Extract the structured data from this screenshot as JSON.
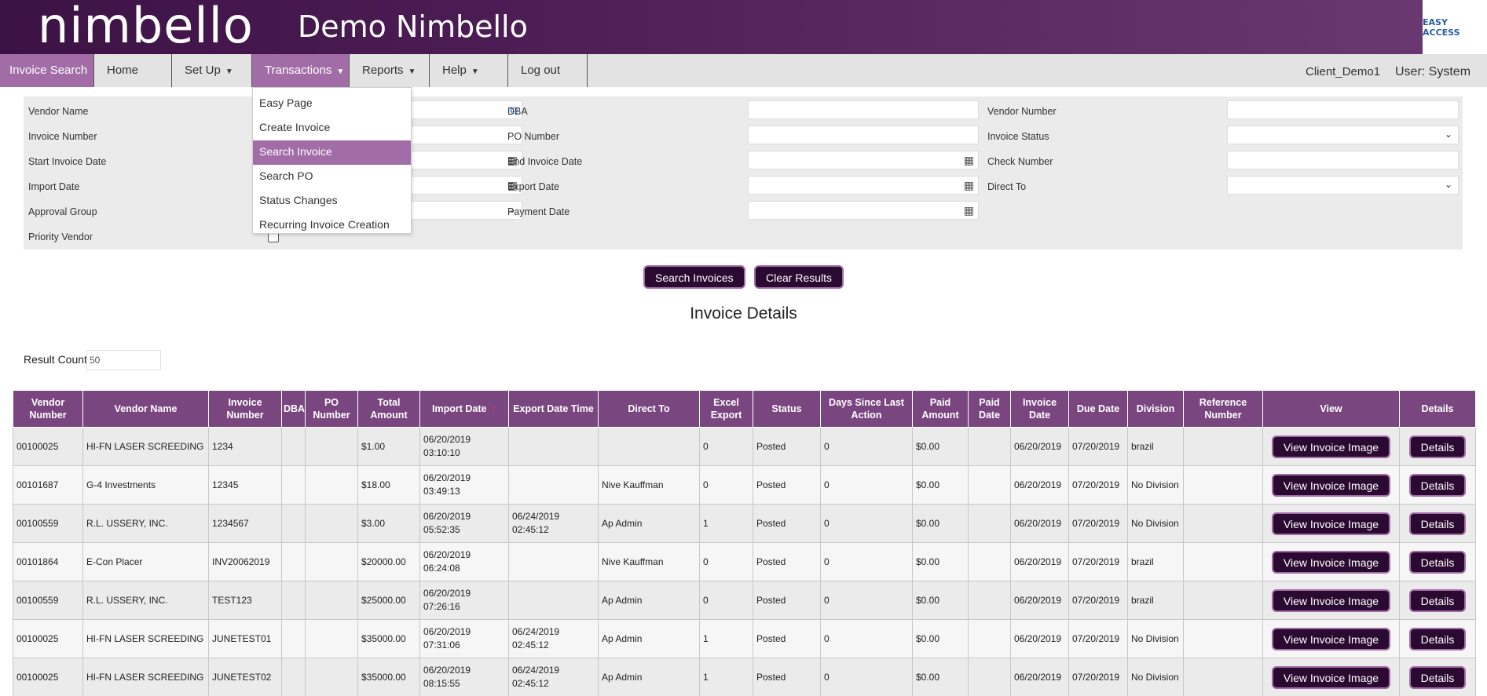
{
  "header": {
    "logo": "nimbello",
    "title": "Demo Nimbello",
    "partner_logo": "EASY ACCESS"
  },
  "nav": {
    "items": [
      {
        "label": "Invoice Search",
        "caret": false
      },
      {
        "label": "Home",
        "caret": false
      },
      {
        "label": "Set Up",
        "caret": true
      },
      {
        "label": "Transactions",
        "caret": true
      },
      {
        "label": "Reports",
        "caret": true
      },
      {
        "label": "Help",
        "caret": true
      },
      {
        "label": "Log out",
        "caret": false
      }
    ],
    "caret_glyph": "▼",
    "client": "Client_Demo1",
    "user": "User: System"
  },
  "transactions_menu": {
    "items": [
      "Easy Page",
      "Create Invoice",
      "Search Invoice",
      "Search PO",
      "Status Changes",
      "Recurring Invoice Creation"
    ],
    "selected": "Search Invoice"
  },
  "filters": {
    "vendor_name": {
      "label": "Vendor Name",
      "value": ""
    },
    "dba": {
      "label": "DBA",
      "value": ""
    },
    "vendor_number": {
      "label": "Vendor Number",
      "value": ""
    },
    "invoice_number": {
      "label": "Invoice Number",
      "value": ""
    },
    "po_number": {
      "label": "PO Number",
      "value": ""
    },
    "invoice_status": {
      "label": "Invoice Status",
      "value": ""
    },
    "start_invoice_date": {
      "label": "Start Invoice Date",
      "value": ""
    },
    "end_invoice_date": {
      "label": "End Invoice Date",
      "value": ""
    },
    "check_number": {
      "label": "Check Number",
      "value": ""
    },
    "import_date": {
      "label": "Import Date",
      "value": ""
    },
    "export_date": {
      "label": "Export Date",
      "value": ""
    },
    "direct_to": {
      "label": "Direct To",
      "value": ""
    },
    "approval_group": {
      "label": "Approval Group",
      "value": ""
    },
    "payment_date": {
      "label": "Payment Date",
      "value": ""
    },
    "priority_vendor": {
      "label": "Priority Vendor",
      "checked": false
    }
  },
  "icons": {
    "external_link": "⧉",
    "calendar": "▦",
    "chevron_down": "⌄"
  },
  "actions": {
    "search": "Search Invoices",
    "clear": "Clear Results"
  },
  "section_title": "Invoice Details",
  "result_count": {
    "label": "Result Count",
    "value": "50"
  },
  "table": {
    "columns": [
      "Vendor Number",
      "Vendor Name",
      "Invoice Number",
      "DBA",
      "PO Number",
      "Total Amount",
      "Import Date",
      "Export Date Time",
      "Direct To",
      "Excel Export",
      "Status",
      "Days Since Last Action",
      "Paid Amount",
      "Paid Date",
      "Invoice Date",
      "Due Date",
      "Division",
      "Reference Number",
      "View",
      "Details"
    ],
    "sort_indicator": "↑",
    "view_button": "View Invoice Image",
    "details_button": "Details",
    "rows": [
      {
        "vendor_number": "00100025",
        "vendor_name": "HI-FN LASER SCREEDING",
        "invoice_number": "1234",
        "dba": "",
        "po_number": "",
        "total_amount": "$1.00",
        "import_date": "06/20/2019 03:10:10",
        "export_date_time": "",
        "direct_to": "",
        "excel_export": "0",
        "status": "Posted",
        "days_since": "0",
        "paid_amount": "$0.00",
        "paid_date": "",
        "invoice_date": "06/20/2019",
        "due_date": "07/20/2019",
        "division": "brazil",
        "reference_number": ""
      },
      {
        "vendor_number": "00101687",
        "vendor_name": "G-4 Investments",
        "invoice_number": "12345",
        "dba": "",
        "po_number": "",
        "total_amount": "$18.00",
        "import_date": "06/20/2019 03:49:13",
        "export_date_time": "",
        "direct_to": "Nive Kauffman",
        "excel_export": "0",
        "status": "Posted",
        "days_since": "0",
        "paid_amount": "$0.00",
        "paid_date": "",
        "invoice_date": "06/20/2019",
        "due_date": "07/20/2019",
        "division": "No Division",
        "reference_number": ""
      },
      {
        "vendor_number": "00100559",
        "vendor_name": "R.L. USSERY, INC.",
        "invoice_number": "1234567",
        "dba": "",
        "po_number": "",
        "total_amount": "$3.00",
        "import_date": "06/20/2019 05:52:35",
        "export_date_time": "06/24/2019 02:45:12",
        "direct_to": "Ap Admin",
        "excel_export": "1",
        "status": "Posted",
        "days_since": "0",
        "paid_amount": "$0.00",
        "paid_date": "",
        "invoice_date": "06/20/2019",
        "due_date": "07/20/2019",
        "division": "No Division",
        "reference_number": ""
      },
      {
        "vendor_number": "00101864",
        "vendor_name": "E-Con Placer",
        "invoice_number": "INV20062019",
        "dba": "",
        "po_number": "",
        "total_amount": "$20000.00",
        "import_date": "06/20/2019 06:24:08",
        "export_date_time": "",
        "direct_to": "Nive Kauffman",
        "excel_export": "0",
        "status": "Posted",
        "days_since": "0",
        "paid_amount": "$0.00",
        "paid_date": "",
        "invoice_date": "06/20/2019",
        "due_date": "07/20/2019",
        "division": "brazil",
        "reference_number": ""
      },
      {
        "vendor_number": "00100559",
        "vendor_name": "R.L. USSERY, INC.",
        "invoice_number": "TEST123",
        "dba": "",
        "po_number": "",
        "total_amount": "$25000.00",
        "import_date": "06/20/2019 07:26:16",
        "export_date_time": "",
        "direct_to": "Ap Admin",
        "excel_export": "0",
        "status": "Posted",
        "days_since": "0",
        "paid_amount": "$0.00",
        "paid_date": "",
        "invoice_date": "06/20/2019",
        "due_date": "07/20/2019",
        "division": "brazil",
        "reference_number": ""
      },
      {
        "vendor_number": "00100025",
        "vendor_name": "HI-FN LASER SCREEDING",
        "invoice_number": "JUNETEST01",
        "dba": "",
        "po_number": "",
        "total_amount": "$35000.00",
        "import_date": "06/20/2019 07:31:06",
        "export_date_time": "06/24/2019 02:45:12",
        "direct_to": "Ap Admin",
        "excel_export": "1",
        "status": "Posted",
        "days_since": "0",
        "paid_amount": "$0.00",
        "paid_date": "",
        "invoice_date": "06/20/2019",
        "due_date": "07/20/2019",
        "division": "No Division",
        "reference_number": ""
      },
      {
        "vendor_number": "00100025",
        "vendor_name": "HI-FN LASER SCREEDING",
        "invoice_number": "JUNETEST02",
        "dba": "",
        "po_number": "",
        "total_amount": "$35000.00",
        "import_date": "06/20/2019 08:15:55",
        "export_date_time": "06/24/2019 02:45:12",
        "direct_to": "Ap Admin",
        "excel_export": "1",
        "status": "Posted",
        "days_since": "0",
        "paid_amount": "$0.00",
        "paid_date": "",
        "invoice_date": "06/20/2019",
        "due_date": "07/20/2019",
        "division": "No Division",
        "reference_number": ""
      }
    ]
  }
}
